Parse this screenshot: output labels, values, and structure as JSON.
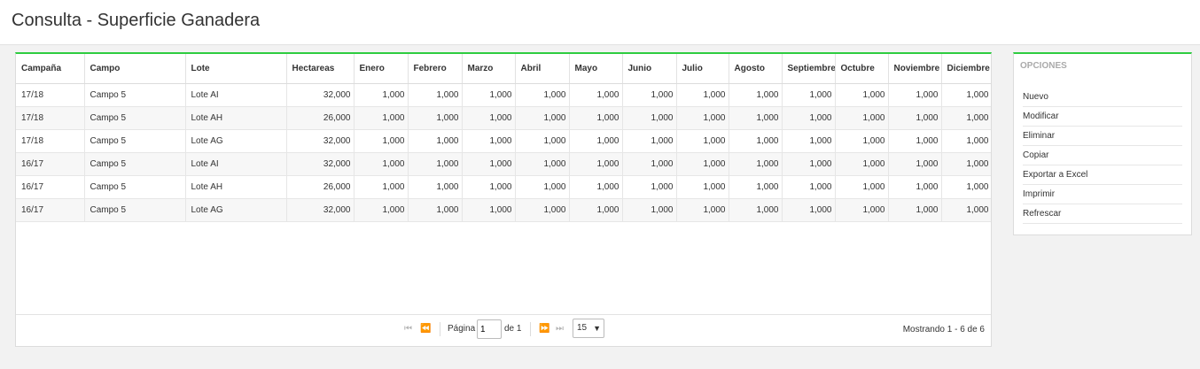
{
  "header": {
    "title": "Consulta - Superficie Ganadera"
  },
  "grid": {
    "columns": [
      "Campaña",
      "Campo",
      "Lote",
      "Hectareas",
      "Enero",
      "Febrero",
      "Marzo",
      "Abril",
      "Mayo",
      "Junio",
      "Julio",
      "Agosto",
      "Septiembre",
      "Octubre",
      "Noviembre",
      "Diciembre"
    ],
    "rows": [
      [
        "17/18",
        "Campo 5",
        "Lote AI",
        "32,000",
        "1,000",
        "1,000",
        "1,000",
        "1,000",
        "1,000",
        "1,000",
        "1,000",
        "1,000",
        "1,000",
        "1,000",
        "1,000",
        "1,000"
      ],
      [
        "17/18",
        "Campo 5",
        "Lote AH",
        "26,000",
        "1,000",
        "1,000",
        "1,000",
        "1,000",
        "1,000",
        "1,000",
        "1,000",
        "1,000",
        "1,000",
        "1,000",
        "1,000",
        "1,000"
      ],
      [
        "17/18",
        "Campo 5",
        "Lote AG",
        "32,000",
        "1,000",
        "1,000",
        "1,000",
        "1,000",
        "1,000",
        "1,000",
        "1,000",
        "1,000",
        "1,000",
        "1,000",
        "1,000",
        "1,000"
      ],
      [
        "16/17",
        "Campo 5",
        "Lote AI",
        "32,000",
        "1,000",
        "1,000",
        "1,000",
        "1,000",
        "1,000",
        "1,000",
        "1,000",
        "1,000",
        "1,000",
        "1,000",
        "1,000",
        "1,000"
      ],
      [
        "16/17",
        "Campo 5",
        "Lote AH",
        "26,000",
        "1,000",
        "1,000",
        "1,000",
        "1,000",
        "1,000",
        "1,000",
        "1,000",
        "1,000",
        "1,000",
        "1,000",
        "1,000",
        "1,000"
      ],
      [
        "16/17",
        "Campo 5",
        "Lote AG",
        "32,000",
        "1,000",
        "1,000",
        "1,000",
        "1,000",
        "1,000",
        "1,000",
        "1,000",
        "1,000",
        "1,000",
        "1,000",
        "1,000",
        "1,000"
      ]
    ]
  },
  "pager": {
    "page_label": "Página",
    "page_value": "1",
    "of_label": "de 1",
    "page_size": "15",
    "showing": "Mostrando 1 - 6 de 6"
  },
  "options": {
    "title": "OPCIONES",
    "items": [
      "Nuevo",
      "Modificar",
      "Eliminar",
      "Copiar",
      "Exportar a Excel",
      "Imprimir",
      "Refrescar"
    ]
  },
  "colors": {
    "accent": "#2ecc40"
  }
}
